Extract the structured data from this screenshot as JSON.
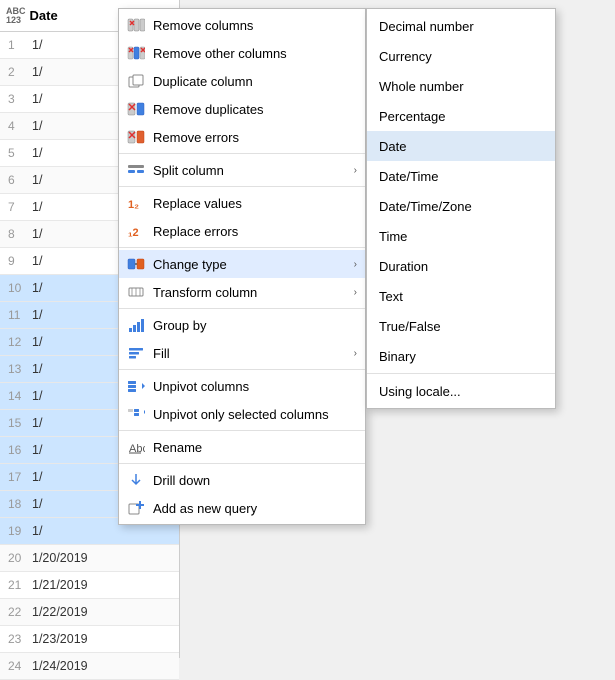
{
  "table": {
    "column_header": "Date",
    "col_type_line1": "ABC",
    "col_type_line2": "123",
    "rows": [
      {
        "id": 1,
        "value": "1/",
        "highlighted": false
      },
      {
        "id": 2,
        "value": "1/",
        "highlighted": false
      },
      {
        "id": 3,
        "value": "1/",
        "highlighted": false
      },
      {
        "id": 4,
        "value": "1/",
        "highlighted": false
      },
      {
        "id": 5,
        "value": "1/",
        "highlighted": false
      },
      {
        "id": 6,
        "value": "1/",
        "highlighted": false
      },
      {
        "id": 7,
        "value": "1/",
        "highlighted": false
      },
      {
        "id": 8,
        "value": "1/",
        "highlighted": false
      },
      {
        "id": 9,
        "value": "1/",
        "highlighted": false
      },
      {
        "id": 10,
        "value": "1/",
        "highlighted": true
      },
      {
        "id": 11,
        "value": "1/",
        "highlighted": true
      },
      {
        "id": 12,
        "value": "1/",
        "highlighted": true
      },
      {
        "id": 13,
        "value": "1/",
        "highlighted": true
      },
      {
        "id": 14,
        "value": "1/",
        "highlighted": true
      },
      {
        "id": 15,
        "value": "1/",
        "highlighted": true
      },
      {
        "id": 16,
        "value": "1/",
        "highlighted": true
      },
      {
        "id": 17,
        "value": "1/",
        "highlighted": true
      },
      {
        "id": 18,
        "value": "1/",
        "highlighted": true
      },
      {
        "id": 19,
        "value": "1/",
        "highlighted": true
      },
      {
        "id": 20,
        "value": "1/20/2019",
        "highlighted": false
      },
      {
        "id": 21,
        "value": "1/21/2019",
        "highlighted": false
      },
      {
        "id": 22,
        "value": "1/22/2019",
        "highlighted": false
      },
      {
        "id": 23,
        "value": "1/23/2019",
        "highlighted": false
      },
      {
        "id": 24,
        "value": "1/24/2019",
        "highlighted": false
      }
    ]
  },
  "context_menu": {
    "items": [
      {
        "id": "remove-columns",
        "label": "Remove columns",
        "has_arrow": false
      },
      {
        "id": "remove-other-columns",
        "label": "Remove other columns",
        "has_arrow": false
      },
      {
        "id": "duplicate-column",
        "label": "Duplicate column",
        "has_arrow": false
      },
      {
        "id": "remove-duplicates",
        "label": "Remove duplicates",
        "has_arrow": false
      },
      {
        "id": "remove-errors",
        "label": "Remove errors",
        "has_arrow": false
      },
      {
        "id": "split-column",
        "label": "Split column",
        "has_arrow": true
      },
      {
        "id": "replace-values",
        "label": "Replace values",
        "has_arrow": false
      },
      {
        "id": "replace-errors",
        "label": "Replace errors",
        "has_arrow": false
      },
      {
        "id": "change-type",
        "label": "Change type",
        "has_arrow": true,
        "active": true
      },
      {
        "id": "transform-column",
        "label": "Transform column",
        "has_arrow": true
      },
      {
        "id": "group-by",
        "label": "Group by",
        "has_arrow": false
      },
      {
        "id": "fill",
        "label": "Fill",
        "has_arrow": true
      },
      {
        "id": "unpivot-columns",
        "label": "Unpivot columns",
        "has_arrow": false
      },
      {
        "id": "unpivot-only-selected",
        "label": "Unpivot only selected columns",
        "has_arrow": false
      },
      {
        "id": "rename",
        "label": "Rename",
        "has_arrow": false
      },
      {
        "id": "drill-down",
        "label": "Drill down",
        "has_arrow": false
      },
      {
        "id": "add-as-new-query",
        "label": "Add as new query",
        "has_arrow": false
      }
    ]
  },
  "submenu_changetype": {
    "items": [
      {
        "id": "decimal-number",
        "label": "Decimal number",
        "selected": false
      },
      {
        "id": "currency",
        "label": "Currency",
        "selected": false
      },
      {
        "id": "whole-number",
        "label": "Whole number",
        "selected": false
      },
      {
        "id": "percentage",
        "label": "Percentage",
        "selected": false
      },
      {
        "id": "date",
        "label": "Date",
        "selected": true
      },
      {
        "id": "datetime",
        "label": "Date/Time",
        "selected": false
      },
      {
        "id": "datetimezone",
        "label": "Date/Time/Zone",
        "selected": false
      },
      {
        "id": "time",
        "label": "Time",
        "selected": false
      },
      {
        "id": "duration",
        "label": "Duration",
        "selected": false
      },
      {
        "id": "text",
        "label": "Text",
        "selected": false
      },
      {
        "id": "true-false",
        "label": "True/False",
        "selected": false
      },
      {
        "id": "binary",
        "label": "Binary",
        "selected": false
      },
      {
        "id": "using-locale",
        "label": "Using locale...",
        "selected": false
      }
    ]
  }
}
